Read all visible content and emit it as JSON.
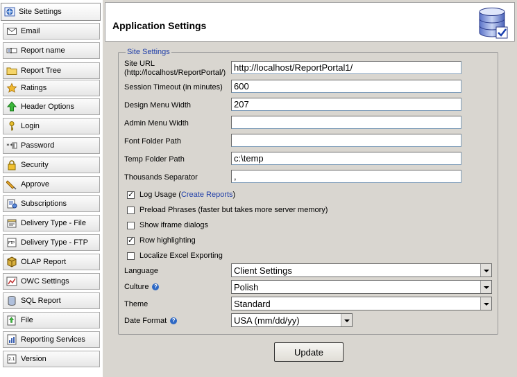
{
  "nav": {
    "items": [
      {
        "label": "Site Settings",
        "icon": "site-settings-icon"
      },
      {
        "label": "Email",
        "icon": "email-icon"
      },
      {
        "label": "Report name",
        "icon": "report-name-icon"
      },
      {
        "label": "Report Tree",
        "icon": "folder-icon"
      },
      {
        "label": "Ratings",
        "icon": "star-icon"
      },
      {
        "label": "Header Options",
        "icon": "green-arrow-up-icon"
      },
      {
        "label": "Login",
        "icon": "key-icon"
      },
      {
        "label": "Password",
        "icon": "password-field-icon"
      },
      {
        "label": "Security",
        "icon": "lock-icon"
      },
      {
        "label": "Approve",
        "icon": "pencil-approve-icon"
      },
      {
        "label": "Subscriptions",
        "icon": "subscriptions-icon"
      },
      {
        "label": "Delivery Type - File",
        "icon": "delivery-file-icon"
      },
      {
        "label": "Delivery Type - FTP",
        "icon": "delivery-ftp-icon"
      },
      {
        "label": "OLAP Report",
        "icon": "cube-icon"
      },
      {
        "label": "OWC Settings",
        "icon": "owc-icon"
      },
      {
        "label": "SQL Report",
        "icon": "database-icon"
      },
      {
        "label": "File",
        "icon": "file-upload-icon"
      },
      {
        "label": "Reporting Services",
        "icon": "reporting-services-icon"
      },
      {
        "label": "Version",
        "icon": "version-icon"
      }
    ]
  },
  "header": {
    "title": "Application Settings"
  },
  "form": {
    "legend": "Site Settings",
    "site_url": {
      "label_line1": "Site URL",
      "label_line2": "(http://localhost/ReportPortal/)",
      "value": "http://localhost/ReportPortal1/"
    },
    "session_timeout": {
      "label": "Session Timeout (in minutes)",
      "value": "600"
    },
    "design_menu_width": {
      "label": "Design Menu Width",
      "value": "207"
    },
    "admin_menu_width": {
      "label": "Admin Menu Width",
      "value": ""
    },
    "font_folder_path": {
      "label": "Font Folder Path",
      "value": ""
    },
    "temp_folder_path": {
      "label": "Temp Folder Path",
      "value": "c:\\temp"
    },
    "thousands_separator": {
      "label": "Thousands Separator",
      "value": ","
    },
    "log_usage": {
      "label": "Log Usage (",
      "link": "Create Reports",
      "suffix": ")",
      "checked": true
    },
    "preload_phrases": {
      "label": "Preload Phrases (faster but takes more server memory)",
      "checked": false
    },
    "show_iframe_dialogs": {
      "label": "Show iframe dialogs",
      "checked": false
    },
    "row_highlighting": {
      "label": "Row highlighting",
      "checked": true
    },
    "localize_excel": {
      "label": "Localize Excel Exporting",
      "checked": false
    },
    "language": {
      "label": "Language",
      "value": "Client Settings"
    },
    "culture": {
      "label": "Culture",
      "value": "Polish"
    },
    "theme": {
      "label": "Theme",
      "value": "Standard"
    },
    "date_format": {
      "label": "Date Format",
      "value": "USA (mm/dd/yy)"
    }
  },
  "actions": {
    "update_label": "Update"
  }
}
